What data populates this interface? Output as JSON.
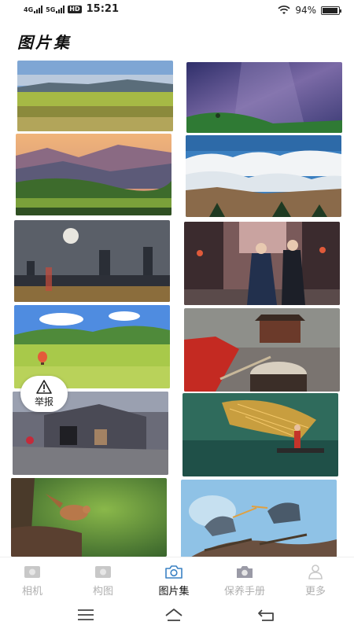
{
  "status_bar": {
    "signal1": "4G",
    "signal2": "5G",
    "hd": "HD",
    "time": "15:21",
    "battery_text": "94%",
    "battery_level": 0.94
  },
  "header": {
    "title": "图片集"
  },
  "gallery": {
    "photos": [
      {
        "name": "grassland-landscape",
        "colors": [
          "#7aa3d1",
          "#a8c24b",
          "#8a7c3a"
        ]
      },
      {
        "name": "starry-sky-hill",
        "colors": [
          "#3a3b7a",
          "#7a6aa8",
          "#3c7a3c"
        ]
      },
      {
        "name": "mountain-sunset-valley",
        "colors": [
          "#e5a56a",
          "#6c5f83",
          "#3e6b2f"
        ]
      },
      {
        "name": "sea-of-clouds",
        "colors": [
          "#4d86c0",
          "#e8eef3",
          "#7a5a3a"
        ]
      },
      {
        "name": "city-moon-night",
        "colors": [
          "#555b66",
          "#2a2e36",
          "#d8a048"
        ]
      },
      {
        "name": "couple-ancient-street",
        "colors": [
          "#b07e73",
          "#3b2b2b",
          "#22304d"
        ]
      },
      {
        "name": "green-meadow-balloon",
        "colors": [
          "#4f8ce0",
          "#6fa83a",
          "#b9d24a"
        ]
      },
      {
        "name": "drum-village-square",
        "colors": [
          "#8a8a8a",
          "#c23a2a",
          "#6b5a4a"
        ]
      },
      {
        "name": "old-stone-cottage",
        "colors": [
          "#6b6a7a",
          "#8a7a6a",
          "#3b3e44"
        ]
      },
      {
        "name": "fisherman-net-river",
        "colors": [
          "#2f6f5f",
          "#e3a73a",
          "#173e3a"
        ]
      },
      {
        "name": "bird-on-branch",
        "colors": [
          "#3f6f35",
          "#7aa04a",
          "#8a5a3a"
        ]
      },
      {
        "name": "herons-on-branch",
        "colors": [
          "#7fb8e0",
          "#c6ddef",
          "#5a4a3a"
        ]
      }
    ]
  },
  "report": {
    "label": "举报",
    "icon": "warning-icon"
  },
  "tabs": [
    {
      "label": "相机",
      "icon": "camera-icon",
      "active": false
    },
    {
      "label": "构图",
      "icon": "composition-icon",
      "active": false
    },
    {
      "label": "图片集",
      "icon": "gallery-camera-icon",
      "active": true
    },
    {
      "label": "保养手册",
      "icon": "maintenance-camera-icon",
      "active": false
    },
    {
      "label": "更多",
      "icon": "user-icon",
      "active": false
    }
  ],
  "system_nav": {
    "menu_icon": "menu-icon",
    "home_icon": "home-icon",
    "back_icon": "back-icon"
  },
  "colors": {
    "active_tab": "#111111",
    "inactive_tab": "#b0b0b0",
    "accent": "#3b82c4"
  }
}
